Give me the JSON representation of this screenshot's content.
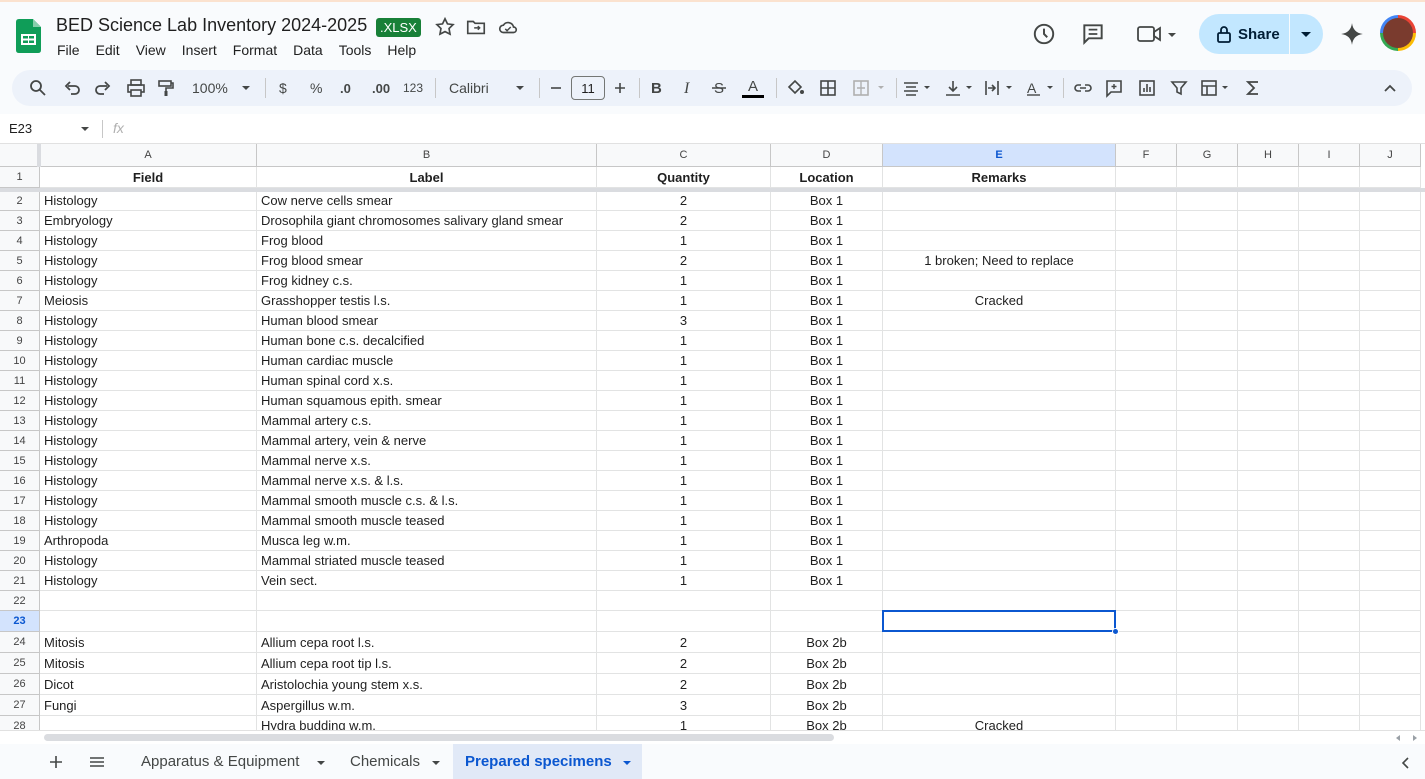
{
  "doc": {
    "title": "BED Science Lab Inventory 2024-2025",
    "badge": ".XLSX"
  },
  "menu": [
    "File",
    "Edit",
    "View",
    "Insert",
    "Format",
    "Data",
    "Tools",
    "Help"
  ],
  "share_label": "Share",
  "toolbar": {
    "zoom": "100%",
    "currency": "$",
    "percent": "%",
    "dec_less": ".0",
    "dec_more": ".00",
    "num_format": "123",
    "font": "Calibri",
    "font_size": "11"
  },
  "formula_bar": {
    "cell_ref": "E23",
    "fx": "fx",
    "content": ""
  },
  "columns": [
    "A",
    "B",
    "C",
    "D",
    "E",
    "F",
    "G",
    "H",
    "I",
    "J"
  ],
  "selected_column": "E",
  "selected_row": "23",
  "header_row": {
    "num": "1",
    "cells": [
      "Field",
      "Label",
      "Quantity",
      "Location",
      "Remarks"
    ]
  },
  "rows": [
    {
      "num": "2",
      "cells": [
        "Histology",
        "Cow nerve cells smear",
        "2",
        "Box 1",
        ""
      ]
    },
    {
      "num": "3",
      "cells": [
        "Embryology",
        "Drosophila giant chromosomes salivary gland smear",
        "2",
        "Box 1",
        ""
      ]
    },
    {
      "num": "4",
      "cells": [
        "Histology",
        "Frog blood",
        "1",
        "Box 1",
        ""
      ]
    },
    {
      "num": "5",
      "cells": [
        "Histology",
        "Frog blood smear",
        "2",
        "Box 1",
        "1 broken; Need to replace"
      ]
    },
    {
      "num": "6",
      "cells": [
        "Histology",
        "Frog kidney c.s.",
        "1",
        "Box 1",
        ""
      ]
    },
    {
      "num": "7",
      "cells": [
        "Meiosis",
        "Grasshopper testis l.s.",
        "1",
        "Box 1",
        "Cracked"
      ]
    },
    {
      "num": "8",
      "cells": [
        "Histology",
        "Human blood smear",
        "3",
        "Box 1",
        ""
      ]
    },
    {
      "num": "9",
      "cells": [
        "Histology",
        "Human bone c.s. decalcified",
        "1",
        "Box 1",
        ""
      ]
    },
    {
      "num": "10",
      "cells": [
        "Histology",
        "Human cardiac muscle",
        "1",
        "Box 1",
        ""
      ]
    },
    {
      "num": "11",
      "cells": [
        "Histology",
        "Human spinal cord x.s.",
        "1",
        "Box 1",
        ""
      ]
    },
    {
      "num": "12",
      "cells": [
        "Histology",
        "Human squamous epith. smear",
        "1",
        "Box 1",
        ""
      ]
    },
    {
      "num": "13",
      "cells": [
        "Histology",
        "Mammal artery c.s.",
        "1",
        "Box 1",
        ""
      ]
    },
    {
      "num": "14",
      "cells": [
        "Histology",
        "Mammal artery, vein & nerve",
        "1",
        "Box 1",
        ""
      ]
    },
    {
      "num": "15",
      "cells": [
        "Histology",
        "Mammal nerve x.s.",
        "1",
        "Box 1",
        ""
      ]
    },
    {
      "num": "16",
      "cells": [
        "Histology",
        "Mammal nerve x.s. & l.s.",
        "1",
        "Box 1",
        ""
      ]
    },
    {
      "num": "17",
      "cells": [
        "Histology",
        "Mammal smooth muscle c.s. & l.s.",
        "1",
        "Box 1",
        ""
      ]
    },
    {
      "num": "18",
      "cells": [
        "Histology",
        "Mammal smooth muscle teased",
        "1",
        "Box 1",
        ""
      ]
    },
    {
      "num": "19",
      "cells": [
        "Arthropoda",
        "Musca leg w.m.",
        "1",
        "Box 1",
        ""
      ]
    },
    {
      "num": "20",
      "cells": [
        "Histology",
        "Mammal striated muscle teased",
        "1",
        "Box 1",
        ""
      ]
    },
    {
      "num": "21",
      "cells": [
        "Histology",
        "Vein sect.",
        "1",
        "Box 1",
        ""
      ]
    },
    {
      "num": "22",
      "cells": [
        "",
        "",
        "",
        "",
        ""
      ]
    },
    {
      "num": "23",
      "cells": [
        "",
        "",
        "",
        "",
        ""
      ]
    },
    {
      "num": "24",
      "cells": [
        "Mitosis",
        "Allium cepa root l.s.",
        "2",
        "Box 2b",
        ""
      ]
    },
    {
      "num": "25",
      "cells": [
        "Mitosis",
        "Allium cepa root tip l.s.",
        "2",
        "Box 2b",
        ""
      ]
    },
    {
      "num": "26",
      "cells": [
        "Dicot",
        "Aristolochia young stem x.s.",
        "2",
        "Box 2b",
        ""
      ]
    },
    {
      "num": "27",
      "cells": [
        "Fungi",
        "Aspergillus w.m.",
        "3",
        "Box 2b",
        ""
      ]
    },
    {
      "num": "28",
      "cells": [
        "",
        "Hydra budding w.m.",
        "1",
        "Box 2b",
        "Cracked"
      ]
    }
  ],
  "sheets": [
    "Apparatus & Equipment",
    "Chemicals",
    "Prepared specimens"
  ],
  "active_sheet": "Prepared specimens",
  "colors": {
    "accent": "#0b57d0",
    "share_bg": "#c2e7ff",
    "xlsx_bg": "#188038",
    "sheets_green": "#0f9d58"
  }
}
